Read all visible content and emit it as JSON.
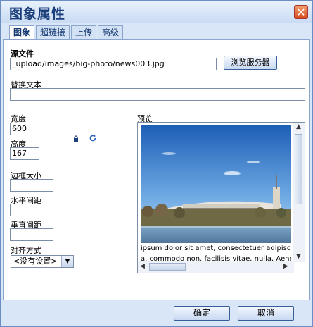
{
  "dialog": {
    "title": "图象属性",
    "close_symbol": "✕"
  },
  "tabs": [
    {
      "label": "图象",
      "active": true
    },
    {
      "label": "超链接",
      "active": false
    },
    {
      "label": "上传",
      "active": false
    },
    {
      "label": "高级",
      "active": false
    }
  ],
  "form": {
    "source_label": "源文件",
    "source_value": "_upload/images/big-photo/news003.jpg",
    "browse_button": "浏览服务器",
    "alt_label": "替换文本",
    "alt_value": "",
    "width_label": "宽度",
    "width_value": "600",
    "height_label": "高度",
    "height_value": "167",
    "border_label": "边框大小",
    "border_value": "",
    "hspace_label": "水平间距",
    "hspace_value": "",
    "vspace_label": "垂直间距",
    "vspace_value": "",
    "align_label": "对齐方式",
    "align_value": "<没有设置>"
  },
  "preview": {
    "label": "预览",
    "text_line1": "ipsum dolor sit amet, consectetuer adipiscing e",
    "text_line2": "a. commodo non. facilisis vitae. nulla. Aenean"
  },
  "footer": {
    "ok_button": "确定",
    "cancel_button": "取消"
  },
  "icons": {
    "lock": "lock-icon",
    "reset": "reset-size-icon"
  }
}
